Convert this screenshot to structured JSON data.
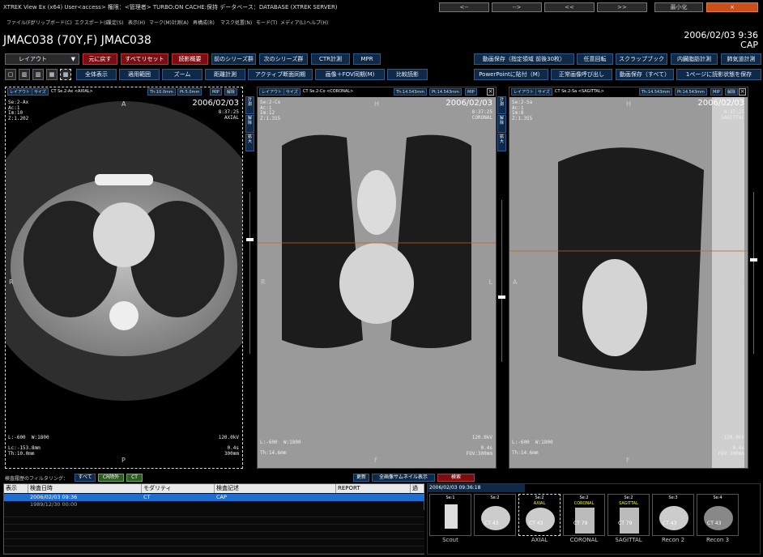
{
  "window": {
    "title": "XTREK View Ex (x64)  User<access>  権限：<管理者>  TURBO:ON  CACHE:保持  データベース：DATABASE (XTREK SERVER)",
    "nav_buttons": [
      "<--",
      "-->",
      "<<",
      ">>"
    ],
    "minimize_label": "最小化",
    "close_label": "×"
  },
  "menu": [
    "ファイル(F)",
    "グリップボード(C)",
    "エクスポート(E)",
    "設定(S)",
    "表示(H)",
    "マーク(M)",
    "計測(A)",
    "再構成(R)",
    "マスク処置(N)",
    "モード(T)",
    "メディア(L)",
    "ヘルプ(H)"
  ],
  "patient": {
    "label": "JMAC038 (70Y,F)  JMAC038"
  },
  "header_right": {
    "date": "2006/02/03 9:36",
    "study": "CAP"
  },
  "toolbar": {
    "layout_label": "レイアウト",
    "row1": [
      "元に戻す",
      "すべてリセット",
      "読影概要",
      "前のシリーズ群",
      "次のシリーズ群",
      "CTR計測",
      "MPR"
    ],
    "row2": [
      "全体表示",
      "適用範囲",
      "ズーム",
      "距離計測",
      "アクティブ断面同期",
      "画像＋FOV同期(M)",
      "比較読影"
    ],
    "right_row1": [
      "動画保存（指定領域 前後30枚）",
      "任意回転",
      "スクラップブック",
      "内臓脂肪計測",
      "肺気道計測"
    ],
    "right_row2": [
      "PowerPointに貼付（M）",
      "正常画像呼び出し",
      "動画保存（すべて）",
      "1ページに読影状態を保存"
    ]
  },
  "viewports": [
    {
      "tabs": [
        "レイアウト",
        "サイズ"
      ],
      "title": "CT Se.2-Ax <AXIAL>",
      "slab_tabs": [
        "Th:10.0mm",
        "Pt:5.0mm",
        "MIP",
        "解除"
      ],
      "date_overlay": "2006/02/03",
      "tl": "Se:2-Ax\nAc:1\nIm:10\nZ:1.202",
      "tr": "8:37:25\nAXIAL",
      "bl": "L:-600  W:1800\n\nLc:-153.8mm\nTh:10.0mm",
      "br": "120.0kV\n\n0.4s\n300mm",
      "orient": {
        "top": "A",
        "left": "R",
        "bottom": "P"
      },
      "side_tabs": [
        "計測",
        "解除",
        "拡大"
      ]
    },
    {
      "tabs": [
        "レイアウト",
        "サイズ"
      ],
      "title": "CT Se.2-Co <CORONAL>",
      "slab_tabs": [
        "Th:14.543mm",
        "Pt:14.543mm",
        "MIP",
        "解除"
      ],
      "date_overlay": "2006/02/03",
      "tl": "Se:2-Co\nAc:1\nIm:12\nZ:1.315",
      "tr": "8:37:25\nCORONAL",
      "bl": "L:-600  W:1800\n\nTh:14.6mm",
      "br": "120.0kV\n\n0.4s\nFOV:300mm",
      "orient": {
        "top": "H",
        "left": "R",
        "right": "L",
        "bottom": "F"
      },
      "side_tabs": [
        "計測",
        "解除",
        "拡大"
      ]
    },
    {
      "tabs": [
        "レイアウト",
        "サイズ"
      ],
      "title": "CT Se.2-Sa <SAGITTAL>",
      "slab_tabs": [
        "Th:14.543mm",
        "Pt:14.543mm",
        "MIP",
        "解除"
      ],
      "date_overlay": "2006/02/03",
      "tl": "Se:2-Sa\nAc:1\nIm:8\nZ:1.355",
      "tr": "8:37:25\nSAGITTAL",
      "bl": "L:-600  W:1800\n\nTh:14.6mm",
      "br": "120.0kV\n\n0.4s\nFOV:300mm",
      "orient": {
        "top": "H",
        "left": "A",
        "right": "P",
        "bottom": "F"
      },
      "side_tabs": []
    }
  ],
  "filter_bar": {
    "label": "検査履歴のフィルタリング：",
    "buttons": [
      "すべて",
      "CR除外",
      "CT"
    ],
    "right_buttons": [
      "更新",
      "全画像サムネイル表示",
      "検索"
    ]
  },
  "study_table": {
    "headers": [
      "表示",
      "検査日時",
      "モダリティ",
      "検査記述",
      "REPORT",
      "過"
    ],
    "rows": [
      {
        "show": "",
        "date": "2006/02/03  09:36",
        "modality": "CT",
        "desc": "CAP",
        "report": "",
        "selected": true
      },
      {
        "show": "",
        "date": "1989/12/30  00:00",
        "modality": "",
        "desc": "",
        "report": "",
        "selected": false
      }
    ]
  },
  "thumbnails": {
    "header": "2006/02/03 09:36:18",
    "items": [
      {
        "num": "Se:1",
        "sub": "",
        "badge": "",
        "label": "Scout"
      },
      {
        "num": "Se:2",
        "sub": "",
        "badge": "CT 43",
        "label": ""
      },
      {
        "num": "Se:2",
        "sub": "AXIAL",
        "badge": "CT 43",
        "label": "AXIAL"
      },
      {
        "num": "Se:2",
        "sub": "CORONAL",
        "badge": "CT 79",
        "label": "CORONAL"
      },
      {
        "num": "Se:2",
        "sub": "SAGITTAL",
        "badge": "CT 79",
        "label": "SAGITTAL"
      },
      {
        "num": "Se:3",
        "sub": "",
        "badge": "CT 43",
        "label": "Recon 2"
      },
      {
        "num": "Se:4",
        "sub": "",
        "badge": "CT 43",
        "label": "Recon 3"
      }
    ]
  }
}
